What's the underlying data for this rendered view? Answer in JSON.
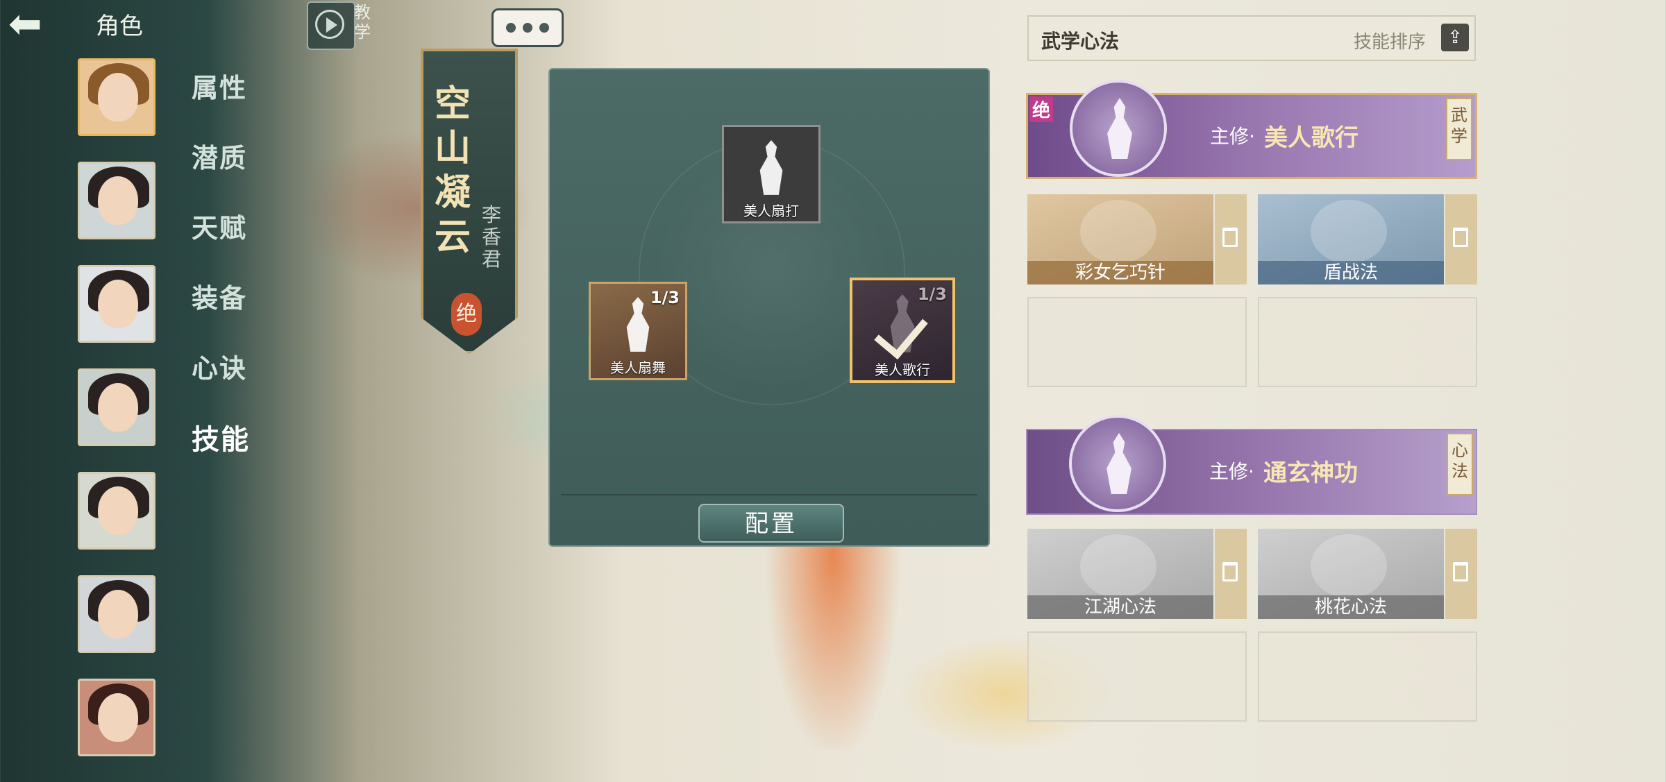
{
  "header": {
    "title": "角色",
    "tutorial_label": "教学"
  },
  "side_menu": {
    "items": [
      {
        "label": "属性",
        "active": false
      },
      {
        "label": "潜质",
        "active": false
      },
      {
        "label": "天赋",
        "active": false
      },
      {
        "label": "装备",
        "active": false
      },
      {
        "label": "心诀",
        "active": false
      },
      {
        "label": "技能",
        "active": true
      }
    ]
  },
  "character": {
    "name": "空山凝云",
    "subname": "李香君",
    "grade_badge": "绝"
  },
  "skill_popup": {
    "slots": [
      {
        "label": "美人扇打",
        "count": "",
        "selected": false
      },
      {
        "label": "美人扇舞",
        "count": "1/3",
        "selected": false
      },
      {
        "label": "美人歌行",
        "count": "1/3",
        "selected": true
      }
    ],
    "config_button": "配置"
  },
  "right_panel": {
    "title": "武学心法",
    "sort_label": "技能排序",
    "martial": {
      "badge": "绝",
      "prefix": "主修·",
      "skill": "美人歌行",
      "tag": "武学",
      "subs": [
        "彩女乞巧针",
        "盾战法"
      ]
    },
    "neigong": {
      "prefix": "主修·",
      "skill": "通玄神功",
      "tag": "心法",
      "subs": [
        "江湖心法",
        "桃花心法"
      ]
    }
  },
  "colors": {
    "main_purple": "#8a68a4",
    "gold_border": "#d8b26a",
    "popup_teal": "#4c6a66"
  }
}
